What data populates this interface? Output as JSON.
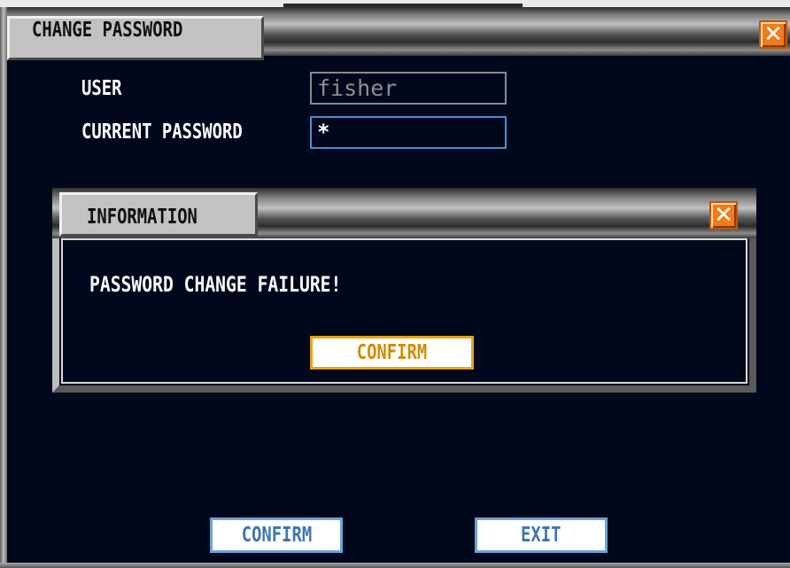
{
  "window": {
    "title": "CHANGE PASSWORD",
    "close_glyph": "✕"
  },
  "form": {
    "user_label": "USER",
    "user_value": "fisher",
    "current_password_label": "CURRENT PASSWORD",
    "current_password_value": "*"
  },
  "information_dialog": {
    "title": "INFORMATION",
    "close_glyph": "✕",
    "message": "PASSWORD CHANGE FAILURE!",
    "confirm_label": "CONFIRM"
  },
  "footer": {
    "confirm_label": "CONFIRM",
    "exit_label": "EXIT"
  },
  "icons": {
    "main_close": "close-icon",
    "info_close": "close-icon"
  },
  "colors": {
    "background": "#02081c",
    "close_button": "#ee7d1b",
    "highlight_border": "#e8a318",
    "button_text_blue": "#3f76ad",
    "button_text_gold": "#d28b00",
    "focus_border": "#4d8fd1"
  }
}
